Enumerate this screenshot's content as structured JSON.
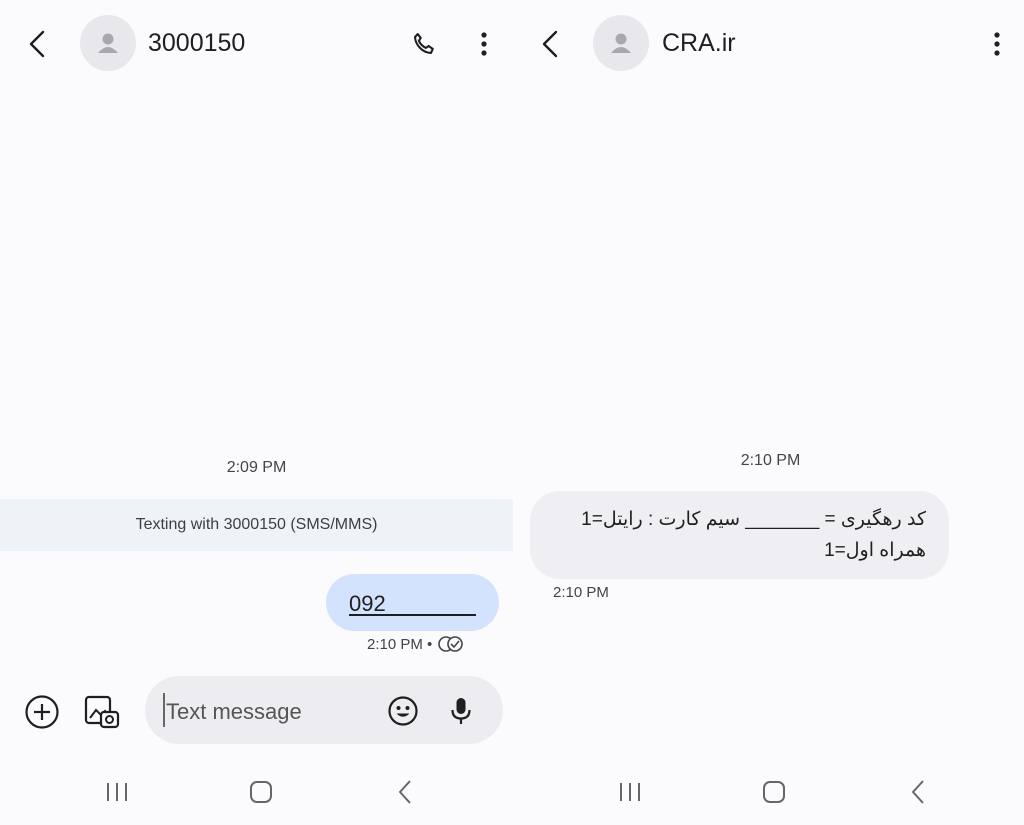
{
  "left": {
    "contact": "3000150",
    "time_header": "2:09 PM",
    "banner": "Texting with 3000150 (SMS/MMS)",
    "sent_message": "092",
    "sent_meta": "2:10 PM •",
    "compose_placeholder": "Text message"
  },
  "right": {
    "contact": "CRA.ir",
    "time_header": "2:10 PM",
    "message_line1": "کد رهگیری = _______ سیم کارت : رایتل=1",
    "message_line2": "همراه اول=1",
    "received_meta": "2:10 PM"
  },
  "colors": {
    "sent_bubble": "#d3e3fd",
    "received_bubble": "#efeff3",
    "banner_bg": "#eef3f8",
    "background": "#fbfbfe"
  },
  "icons": [
    "back-arrow-icon",
    "contact-avatar-icon",
    "phone-icon",
    "more-vert-icon",
    "add-circle-icon",
    "gallery-icon",
    "emoji-icon",
    "mic-icon",
    "read-receipt-icon",
    "recents-icon",
    "home-icon",
    "nav-back-icon"
  ]
}
